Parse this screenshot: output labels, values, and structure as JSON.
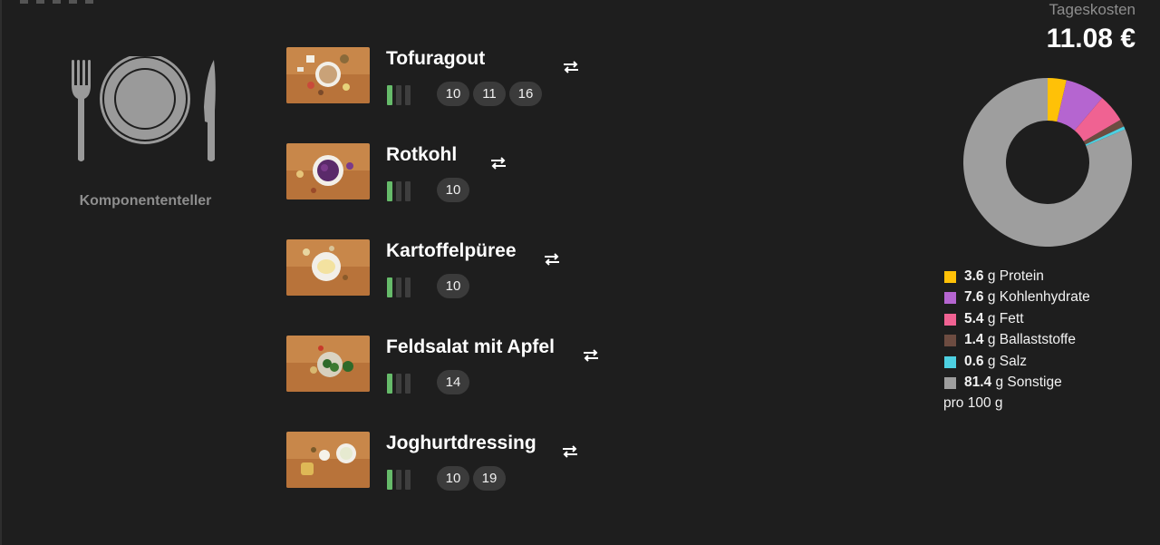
{
  "plate": {
    "label": "Komponententeller"
  },
  "components": [
    {
      "name": "Tofuragout",
      "badges": [
        "10",
        "11",
        "16"
      ]
    },
    {
      "name": "Rotkohl",
      "badges": [
        "10"
      ]
    },
    {
      "name": "Kartoffelpüree",
      "badges": [
        "10"
      ]
    },
    {
      "name": "Feldsalat mit Apfel",
      "badges": [
        "14"
      ]
    },
    {
      "name": "Joghurtdressing",
      "badges": [
        "10",
        "19"
      ]
    }
  ],
  "costs": {
    "label": "Tageskosten",
    "value": "11.08 €"
  },
  "nutrition": {
    "items": [
      {
        "value": "3.6",
        "unit": "g",
        "label": "Protein",
        "color": "#ffc107"
      },
      {
        "value": "7.6",
        "unit": "g",
        "label": "Kohlenhydrate",
        "color": "#b565d0"
      },
      {
        "value": "5.4",
        "unit": "g",
        "label": "Fett",
        "color": "#f06292"
      },
      {
        "value": "1.4",
        "unit": "g",
        "label": "Ballaststoffe",
        "color": "#6d4c41"
      },
      {
        "value": "0.6",
        "unit": "g",
        "label": "Salz",
        "color": "#4dd0e1"
      },
      {
        "value": "81.4",
        "unit": "g",
        "label": "Sonstige",
        "color": "#9e9e9e"
      }
    ],
    "footnote": "pro 100 g"
  },
  "icons": {
    "plate": "cutlery-plate-icon",
    "swap": "swap-arrows-icon"
  },
  "colors": {
    "level_on": "#66bb6a",
    "level_off": "#3e3e3e",
    "badge_bg": "#3b3b3b"
  }
}
